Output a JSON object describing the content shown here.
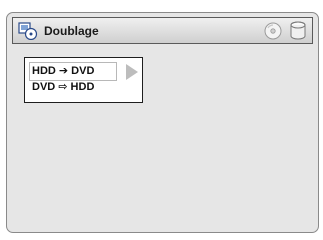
{
  "header": {
    "title": "Doublage",
    "left_icon": "dubbing-icon",
    "right_icons": [
      "disc-icon",
      "hdd-icon"
    ]
  },
  "menu": {
    "items": [
      {
        "label": "HDD ➔ DVD",
        "selected": true
      },
      {
        "label": "DVD ⇨ HDD",
        "selected": false
      }
    ],
    "submenu_indicator": "play-arrow-icon"
  },
  "colors": {
    "screen_bg": "#e6e6e6",
    "titlebar_bg": "#dcdcdc",
    "menu_bg": "#ffffff"
  }
}
